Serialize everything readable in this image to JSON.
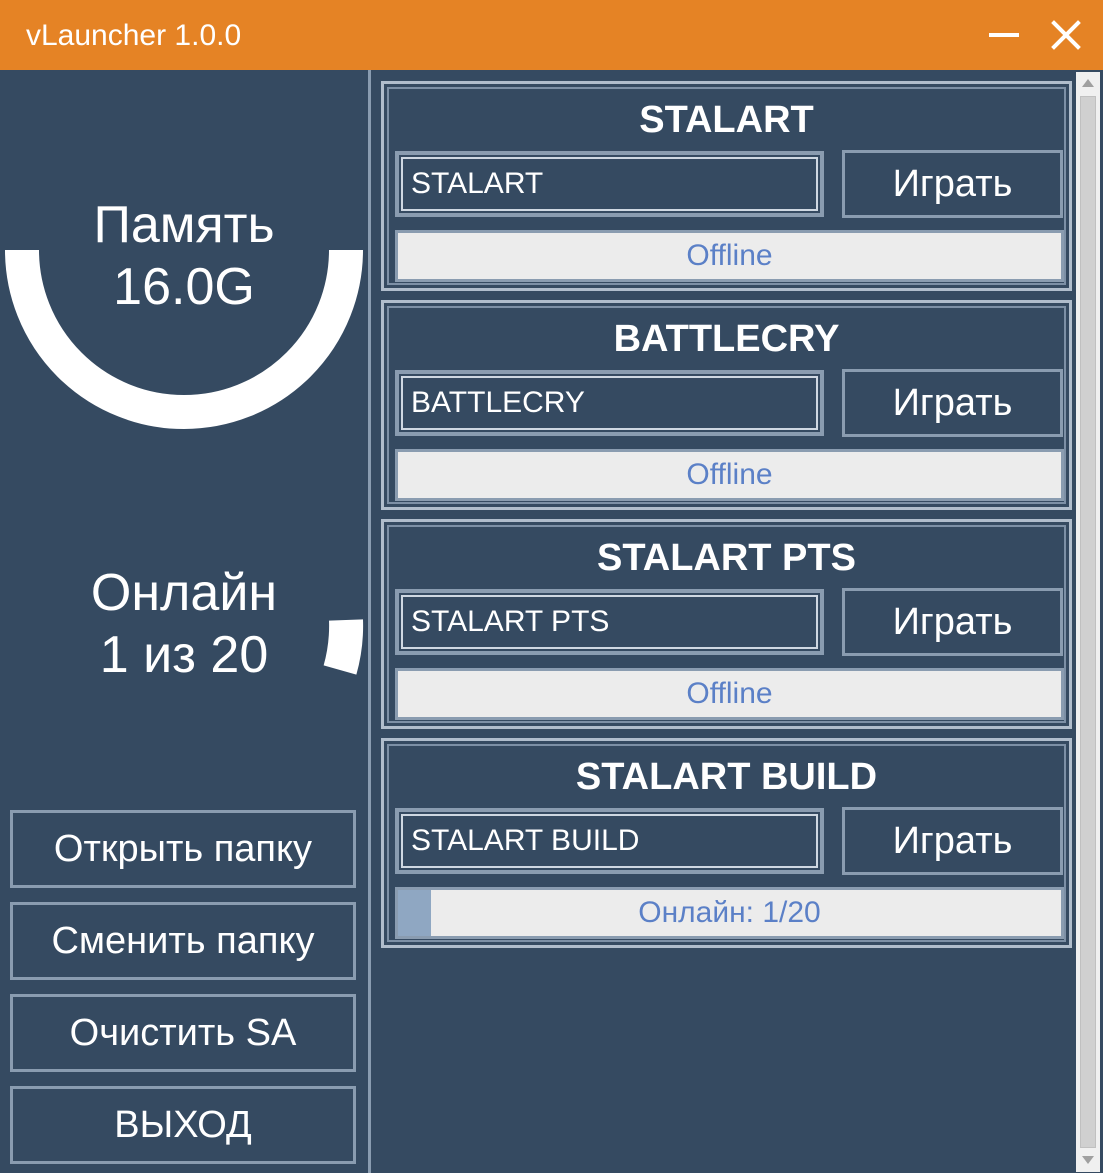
{
  "window": {
    "title": "vLauncher 1.0.0",
    "accent_color": "#e58325",
    "background_color": "#354a61",
    "minimize_icon": "minimize-icon",
    "close_icon": "close-icon"
  },
  "memory": {
    "label": "Память",
    "value": "16.0G"
  },
  "online": {
    "label": "Онлайн",
    "value": "1 из 20",
    "current": 1,
    "max": 20
  },
  "sidebar_buttons": [
    {
      "label": "Открыть папку"
    },
    {
      "label": "Сменить папку"
    },
    {
      "label": "Очистить SA"
    },
    {
      "label": "ВЫХОД"
    }
  ],
  "servers": [
    {
      "title": "STALART",
      "field_value": "STALART",
      "play_label": "Играть",
      "status": "Offline",
      "progress": 0
    },
    {
      "title": "BATTLECRY",
      "field_value": "BATTLECRY",
      "play_label": "Играть",
      "status": "Offline",
      "progress": 0
    },
    {
      "title": "STALART PTS",
      "field_value": "STALART PTS",
      "play_label": "Играть",
      "status": "Offline",
      "progress": 0
    },
    {
      "title": "STALART BUILD",
      "field_value": "STALART BUILD",
      "play_label": "Играть",
      "status": "Онлайн: 1/20",
      "progress": 0.05
    }
  ]
}
